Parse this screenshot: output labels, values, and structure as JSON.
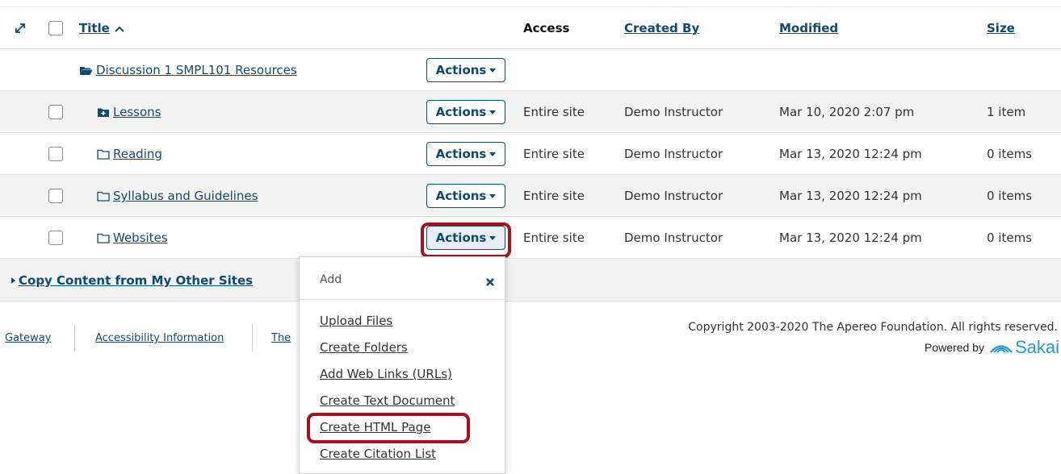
{
  "header": {
    "title": "Title",
    "access": "Access",
    "created_by": "Created By",
    "modified": "Modified",
    "size": "Size"
  },
  "parent_folder": {
    "name": "Discussion 1 SMPL101 Resources",
    "actions_label": "Actions"
  },
  "rows": [
    {
      "name": "Lessons",
      "actions_label": "Actions",
      "access": "Entire site",
      "created_by": "Demo Instructor",
      "modified": "Mar 10, 2020 2:07 pm",
      "size": "1 item"
    },
    {
      "name": "Reading",
      "actions_label": "Actions",
      "access": "Entire site",
      "created_by": "Demo Instructor",
      "modified": "Mar 13, 2020 12:24 pm",
      "size": "0 items"
    },
    {
      "name": "Syllabus and Guidelines",
      "actions_label": "Actions",
      "access": "Entire site",
      "created_by": "Demo Instructor",
      "modified": "Mar 13, 2020 12:24 pm",
      "size": "0 items"
    },
    {
      "name": "Websites",
      "actions_label": "Actions",
      "access": "Entire site",
      "created_by": "Demo Instructor",
      "modified": "Mar 13, 2020 12:24 pm",
      "size": "0 items"
    }
  ],
  "copy_content_label": "Copy Content from My Other Sites",
  "menu": {
    "header": "Add",
    "items": [
      "Upload Files",
      "Create Folders",
      "Add Web Links (URLs)",
      "Create Text Document",
      "Create HTML Page",
      "Create Citation List"
    ]
  },
  "footer": {
    "links": [
      "Gateway",
      "Accessibility Information",
      "The"
    ],
    "copyright": "Copyright 2003-2020 The Apereo Foundation. All rights reserved.",
    "powered_by": "Powered by",
    "brand": "Sakai"
  },
  "colors": {
    "link": "#0f4b70",
    "highlight": "#a3141e",
    "brand": "#1e9ad6"
  }
}
